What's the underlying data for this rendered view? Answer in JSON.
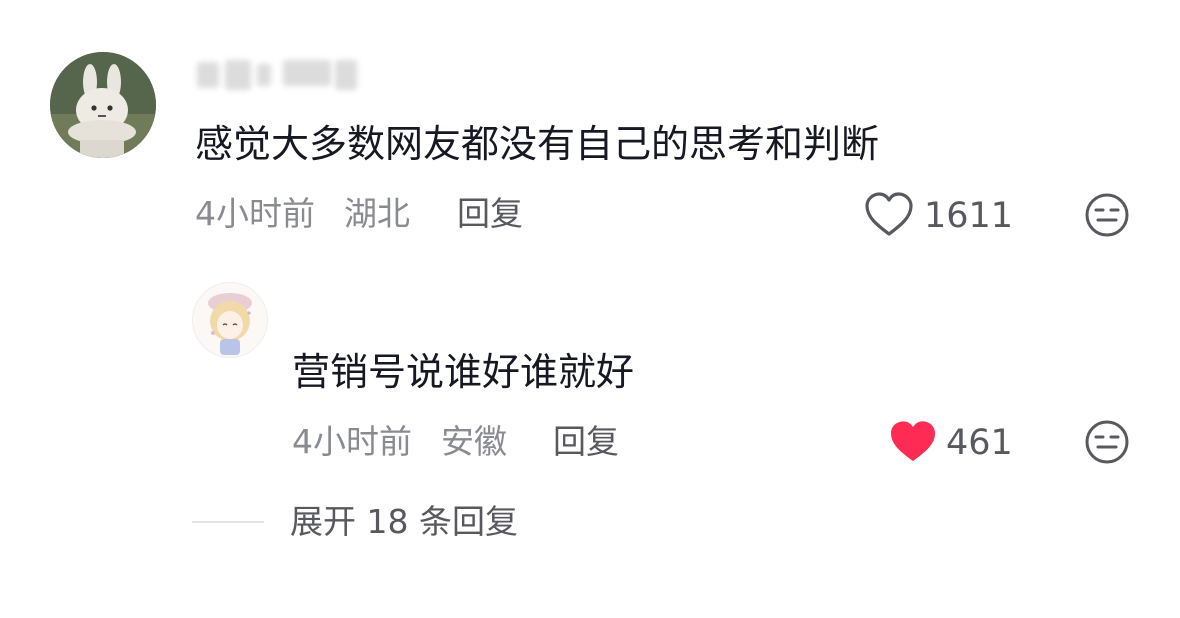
{
  "comment": {
    "text": "感觉大多数网友都没有自己的思考和判断",
    "time": "4小时前",
    "location": "湖北",
    "reply_label": "回复",
    "likes": "1611",
    "liked": false
  },
  "reply": {
    "text": "营销号说谁好谁就好",
    "time": "4小时前",
    "location": "安徽",
    "reply_label": "回复",
    "likes": "461",
    "liked": true
  },
  "expand_replies": {
    "label": "展开 18 条回复"
  },
  "icons": {
    "like": "heart-outline-icon",
    "liked": "heart-filled-icon",
    "dislike": "unamused-face-icon"
  },
  "colors": {
    "liked_heart": "#fe2c55",
    "text_primary": "#161823",
    "text_secondary": "#8a8b91"
  }
}
